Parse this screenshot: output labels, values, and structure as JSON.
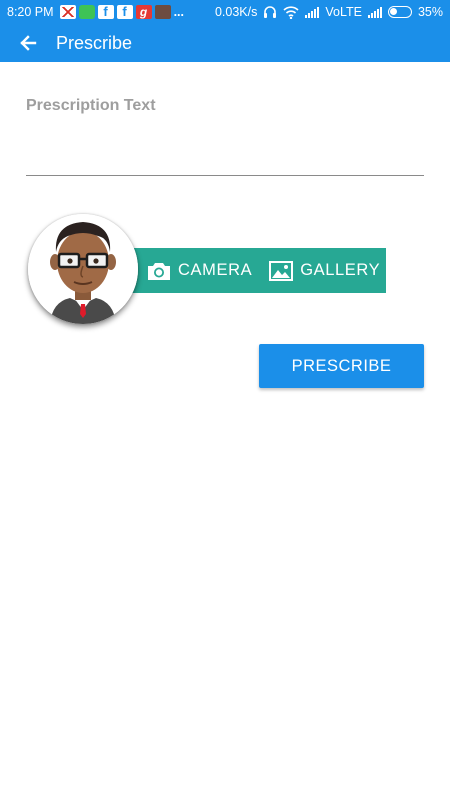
{
  "status_bar": {
    "time": "8:20 PM",
    "more_indicator": "...",
    "net_speed": "0.03K/s",
    "network_type": "VoLTE",
    "battery": "35%",
    "icons": [
      "gmail-icon",
      "phone-icon",
      "facebook-icon",
      "facebook-icon",
      "g-app-icon",
      "game-icon",
      "headset-icon",
      "wifi-icon",
      "signal-icon",
      "battery-icon"
    ]
  },
  "app_bar": {
    "title": "Prescribe",
    "back_icon": "arrow-back-icon"
  },
  "prescription": {
    "label": "Prescription Text",
    "value": "",
    "placeholder": ""
  },
  "image_picker": {
    "camera_label": "CAMERA",
    "gallery_label": "GALLERY",
    "camera_icon": "camera-icon",
    "gallery_icon": "image-icon",
    "color": "#27a894"
  },
  "actions": {
    "prescribe_label": "PRESCRIBE"
  },
  "colors": {
    "primary": "#1b8fe9",
    "accent": "#27a894",
    "label": "#9e9e9e"
  }
}
